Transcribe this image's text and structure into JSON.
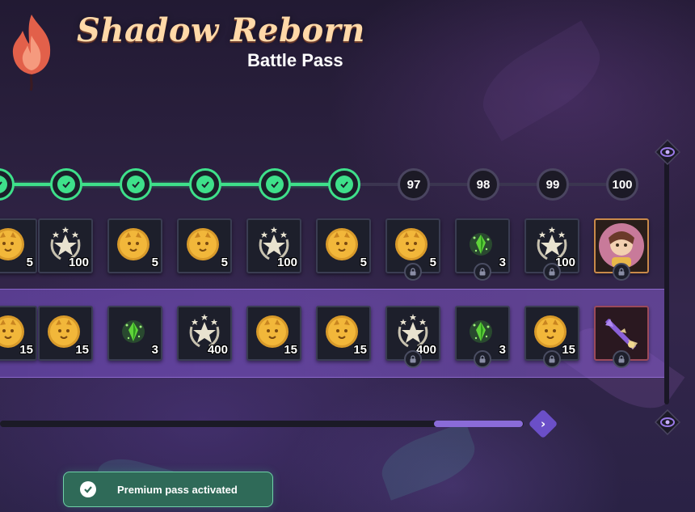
{
  "header": {
    "title": "Shadow Reborn",
    "subtitle": "Battle Pass"
  },
  "track": {
    "completed_nodes": 6,
    "levels": [
      "97",
      "98",
      "99",
      "100"
    ]
  },
  "free_rewards": [
    {
      "icon": "gold-coin-icon",
      "qty": "5",
      "locked": false
    },
    {
      "icon": "star-laurel-icon",
      "qty": "100",
      "locked": false
    },
    {
      "icon": "gold-coin-icon",
      "qty": "5",
      "locked": false
    },
    {
      "icon": "gold-coin-icon",
      "qty": "5",
      "locked": false
    },
    {
      "icon": "star-laurel-icon",
      "qty": "100",
      "locked": false
    },
    {
      "icon": "gold-coin-icon",
      "qty": "5",
      "locked": false
    },
    {
      "icon": "gold-coin-icon",
      "qty": "5",
      "locked": true
    },
    {
      "icon": "green-gem-icon",
      "qty": "3",
      "locked": true
    },
    {
      "icon": "star-laurel-icon",
      "qty": "100",
      "locked": true
    },
    {
      "icon": "character-portrait-icon",
      "qty": "",
      "locked": true
    }
  ],
  "premium_rewards": [
    {
      "icon": "gold-coin-icon",
      "qty": "15",
      "locked": false
    },
    {
      "icon": "gold-coin-icon",
      "qty": "15",
      "locked": false
    },
    {
      "icon": "green-gem-icon",
      "qty": "3",
      "locked": false
    },
    {
      "icon": "star-laurel-icon",
      "qty": "400",
      "locked": false
    },
    {
      "icon": "gold-coin-icon",
      "qty": "15",
      "locked": false
    },
    {
      "icon": "gold-coin-icon",
      "qty": "15",
      "locked": false
    },
    {
      "icon": "star-laurel-icon",
      "qty": "400",
      "locked": true
    },
    {
      "icon": "green-gem-icon",
      "qty": "3",
      "locked": true
    },
    {
      "icon": "gold-coin-icon",
      "qty": "15",
      "locked": true
    },
    {
      "icon": "weapon-icon",
      "qty": "",
      "locked": true
    }
  ],
  "scroll": {
    "horizontal_next_icon": "chevron-right-icon",
    "vertical_up_icon": "portal-icon",
    "vertical_down_icon": "portal-icon"
  },
  "toast": {
    "message": "Premium pass activated"
  },
  "colors": {
    "progress": "#3ee08a",
    "premium_band": "#8a5fd0",
    "title": "#ffd9a8"
  }
}
